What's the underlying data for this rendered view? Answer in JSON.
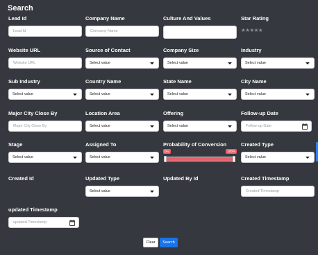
{
  "title": "Search",
  "fields": {
    "lead_id": {
      "label": "Lead Id",
      "placeholder": "Lead Id"
    },
    "company_name": {
      "label": "Company Name",
      "placeholder": "Company Name"
    },
    "culture_values": {
      "label": "Culture And Values",
      "placeholder": ""
    },
    "star_rating": {
      "label": "Star Rating",
      "stars": "★★★★★",
      "value": 0,
      "max": 5
    },
    "website_url": {
      "label": "Website URL",
      "placeholder": "Website URL"
    },
    "source_contact": {
      "label": "Source of Contact",
      "value": "Select value"
    },
    "company_size": {
      "label": "Company Size",
      "value": "Select value"
    },
    "industry": {
      "label": "Industry",
      "value": "Select value"
    },
    "sub_industry": {
      "label": "Sub Industry",
      "value": "Select value"
    },
    "country_name": {
      "label": "Country Name",
      "value": "Select value"
    },
    "state_name": {
      "label": "State Name",
      "value": "Select value"
    },
    "city_name": {
      "label": "City Name",
      "value": "Select value"
    },
    "major_city": {
      "label": "Major City Close By",
      "placeholder": "Major City Close By"
    },
    "location_area": {
      "label": "Location Area",
      "value": "Select value"
    },
    "offering": {
      "label": "Offering",
      "value": "Select value"
    },
    "followup_date": {
      "label": "Follow-up Date",
      "placeholder": "Follow-up Date"
    },
    "stage": {
      "label": "Stage",
      "value": "Select value"
    },
    "assigned_to": {
      "label": "Assigned To",
      "value": "Select value"
    },
    "probability": {
      "label": "Probability of Conversion",
      "min_label": "0%",
      "max_label": "100%",
      "min": 0,
      "max": 100
    },
    "created_type": {
      "label": "Created Type",
      "value": "Select value"
    },
    "created_id": {
      "label": "Created Id"
    },
    "updated_type": {
      "label": "Updated Type",
      "value": "Select value"
    },
    "updated_by_id": {
      "label": "Updated By Id"
    },
    "created_timestamp": {
      "label": "Created Timestamp",
      "placeholder": "Created Timestamp"
    },
    "updated_timestamp": {
      "label": "updated Timestamp",
      "placeholder": "updated Timestamp"
    }
  },
  "buttons": {
    "clear": "Clear",
    "search": "Search"
  },
  "colors": {
    "background": "#35383e",
    "slider": "#e8616a",
    "primary": "#1a73e8"
  }
}
